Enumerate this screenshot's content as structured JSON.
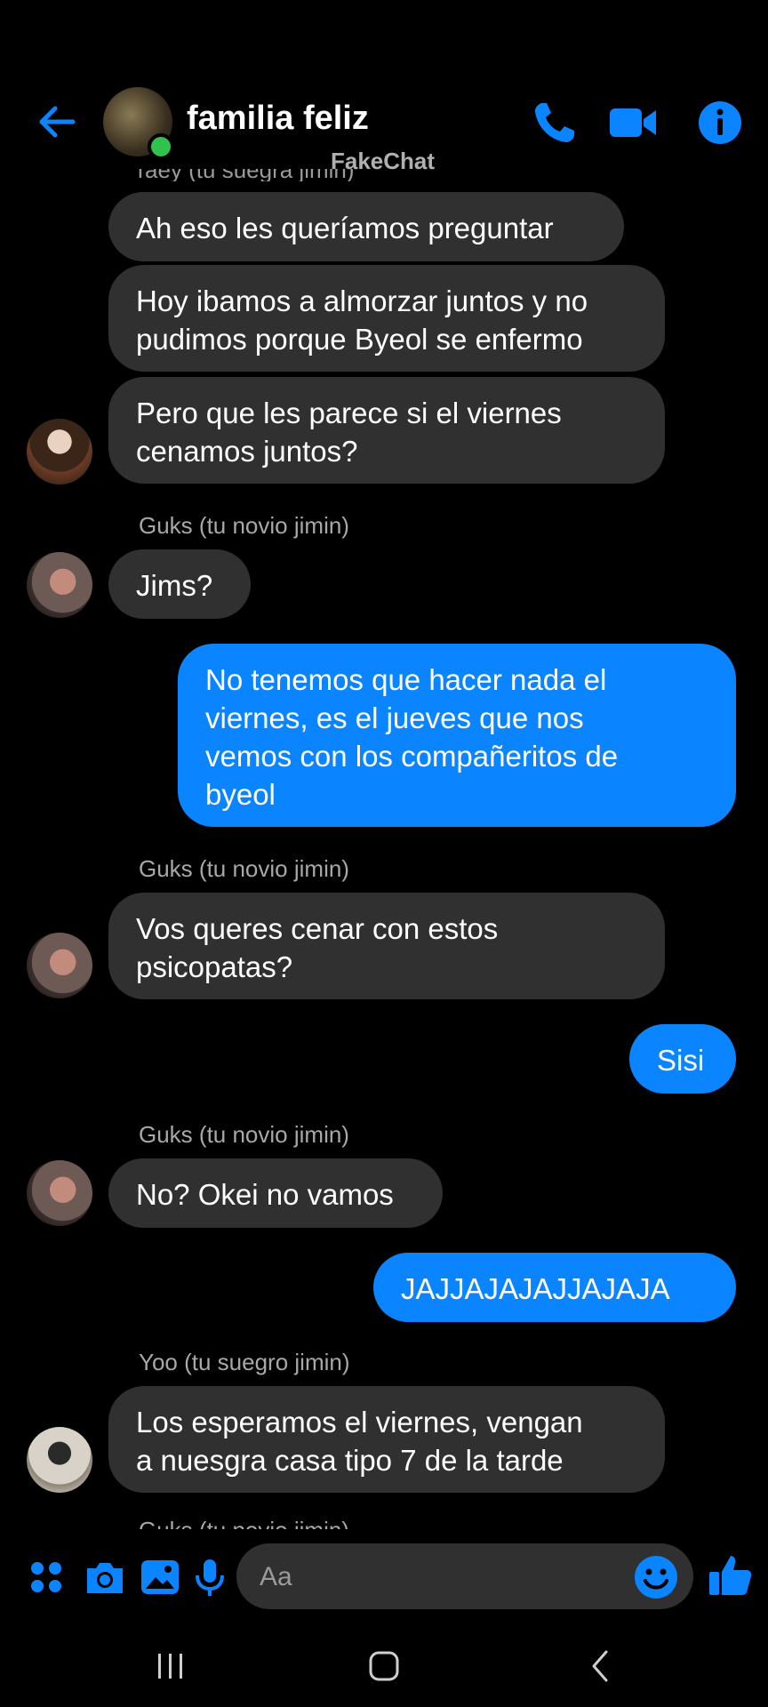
{
  "header": {
    "title": "familia feliz",
    "watermark": "FakeChat",
    "back_icon": "arrow-left-icon",
    "call_icon": "phone-icon",
    "video_icon": "video-camera-icon",
    "info_icon": "info-icon"
  },
  "colors": {
    "accent": "#0a84ff",
    "incoming_bubble": "#303030",
    "background": "#000000",
    "online": "#31c24d"
  },
  "cutoff_top_label": "Taey (tu suegra jimin)",
  "messages": [
    {
      "direction": "in",
      "lines": [
        "Ah eso les queríamos preguntar"
      ]
    },
    {
      "direction": "in",
      "lines": [
        "Hoy ibamos a almorzar juntos y no",
        "pudimos porque Byeol se enfermo"
      ]
    },
    {
      "direction": "in",
      "lines": [
        "Pero que les parece si el viernes",
        "cenamos juntos?"
      ]
    },
    {
      "direction": "in",
      "sender": "Guks (tu novio jimin)",
      "lines": [
        "Jims?"
      ]
    },
    {
      "direction": "out",
      "lines": [
        "No tenemos que hacer nada el",
        "viernes, es el jueves que nos",
        "vemos con los compañeritos de",
        "byeol"
      ]
    },
    {
      "direction": "in",
      "sender": "Guks (tu novio jimin)",
      "lines": [
        "Vos queres cenar con estos",
        "psicopatas?"
      ]
    },
    {
      "direction": "out",
      "lines": [
        "Sisi"
      ]
    },
    {
      "direction": "in",
      "sender": "Guks (tu novio jimin)",
      "lines": [
        "No? Okei no vamos"
      ]
    },
    {
      "direction": "out",
      "lines": [
        "JAJJAJAJAJJAJAJA"
      ]
    },
    {
      "direction": "in",
      "sender": "Yoo (tu suegro jimin)",
      "lines": [
        "Los esperamos el viernes, vengan",
        "a nuesgra casa tipo 7 de la tarde"
      ]
    }
  ],
  "cutoff_bottom_label": "Guks (tu novio jimin)",
  "composer": {
    "placeholder": "Aa",
    "icons": [
      "apps-grid-icon",
      "camera-icon",
      "image-icon",
      "microphone-icon",
      "emoji-icon",
      "thumbs-up-icon"
    ]
  },
  "system_nav": {
    "icons": [
      "recent-apps-icon",
      "home-icon",
      "back-icon"
    ]
  }
}
